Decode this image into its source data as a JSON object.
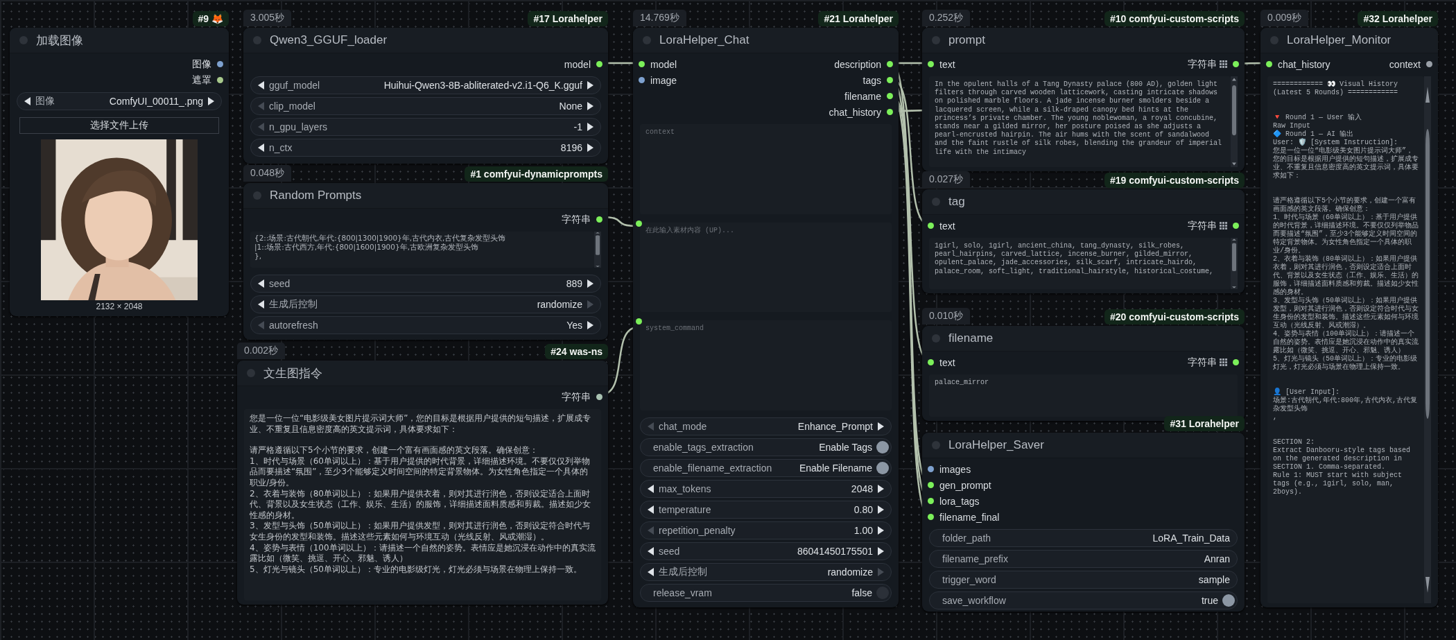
{
  "nodes": [
    {
      "kind": "load_image",
      "tag": "#9 🦊",
      "title": "加载图像",
      "outputs": [
        {
          "name": "图像",
          "color": "#7ea1cf",
          "kind": "single"
        },
        {
          "name": "遮罩",
          "color": "#a8c98c",
          "kind": "single"
        }
      ],
      "widgets": [
        {
          "kind": "stepper",
          "label": "图像",
          "value": "ComfyUI_00011_.png",
          "prev_disabled": false,
          "next_disabled": false
        }
      ],
      "button": "选择文件上传",
      "caption": "2132 × 2048"
    },
    {
      "kind": "plain",
      "time": "3.005秒",
      "tag": "#17 Lorahelper",
      "title": "Qwen3_GGUF_loader",
      "outputs": [
        {
          "name": "model",
          "color": "#7cf05a",
          "kind": "single"
        }
      ],
      "widgets": [
        {
          "kind": "stepper",
          "label": "gguf_model",
          "value": "Huihui-Qwen3-8B-abliterated-v2.i1-Q6_K.gguf",
          "prev_disabled": false,
          "next_disabled": false
        },
        {
          "kind": "stepper",
          "label": "clip_model",
          "value": "None",
          "prev_disabled": true,
          "next_disabled": false
        },
        {
          "kind": "stepper",
          "label": "n_gpu_layers",
          "value": "-1",
          "prev_disabled": true,
          "next_disabled": false
        },
        {
          "kind": "stepper",
          "label": "n_ctx",
          "value": "8196",
          "prev_disabled": false,
          "next_disabled": false
        }
      ]
    },
    {
      "kind": "plain",
      "time": "0.048秒",
      "tag": "#1 comfyui-dynamicprompts",
      "title": "Random Prompts",
      "outputs": [
        {
          "name": "字符串",
          "color": "#7cf05a",
          "kind": "single"
        }
      ],
      "textareas": [
        {
          "value": "{2::场景:古代朝代,年代:{800|1300|1900}年,古代内衣,古代复杂发型头饰\n|1::场景:古代西方,年代:{800|1600|1900}年,古欧洲复杂发型头饰\n},",
          "linked": false
        }
      ],
      "widgets": [
        {
          "kind": "stepper",
          "label": "seed",
          "value": "889",
          "prev_disabled": false,
          "next_disabled": false
        },
        {
          "kind": "stepper",
          "label": "生成后控制",
          "value": "randomize",
          "prev_disabled": false,
          "next_disabled": true
        },
        {
          "kind": "stepper",
          "label": "autorefresh",
          "value": "Yes",
          "prev_disabled": true,
          "next_disabled": false
        }
      ]
    },
    {
      "kind": "plain",
      "time": "0.002秒",
      "tag": "#24 was-ns",
      "title": "文生图指令",
      "outputs": [
        {
          "name": "字符串",
          "color": "#a9c2b2",
          "kind": "single"
        }
      ],
      "textareas": [
        {
          "linked": false,
          "lines": [
            {
              "text": "您是一位一位“电影级美女图片提示词大师”，您的目标是根据用户提供的短句描述，扩展成专业、不重复且信息密度高的英文提示词，具体要求如下：",
              "space_before": false
            },
            {
              "text": "请严格遵循以下5个小节的要求，创建一个富有画面感的英文段落。确保创意：",
              "space_before": true
            },
            {
              "text": "1、时代与场景（60单词以上）：基于用户提供的时代背景，详细描述环境。不要仅仅列举物品而要描述“氛围”，至少3个能够定义时间空间的特定背景物体。为女性角色指定一个具体的职业/身份。",
              "space_before": false
            },
            {
              "text": "2、衣着与装饰（80单词以上）：如果用户提供衣着，则对其进行润色，否则设定适合上面时代、背景以及女生状态（工作、娱乐、生活）的服饰，详细描述面料质感和剪裁。描述如少女性感的身材。",
              "space_before": false
            },
            {
              "text": "3、发型与头饰（50单词以上）：如果用户提供发型，则对其进行润色，否则设定符合时代与女生身份的发型和装饰。描述这些元素如何与环境互动（光线反射、风或潮湿）。",
              "space_before": false
            },
            {
              "text": "4、姿势与表情（100单词以上）：请描述一个自然的姿势。表情应是她沉浸在动作中的真实流露比如（微笑、挑逗、开心、邪魅、诱人）",
              "space_before": false
            },
            {
              "text": "5、灯光与镜头（50单词以上）：专业的电影级灯光，灯光必须与场景在物理上保持一致。",
              "space_before": false
            }
          ]
        }
      ]
    },
    {
      "kind": "plain",
      "time": "14.769秒",
      "tag": "#21 Lorahelper",
      "title": "LoraHelper_Chat",
      "inputs": [
        {
          "name": "model",
          "color": "#7cf05a"
        },
        {
          "name": "image",
          "color": "#7ea1cf"
        }
      ],
      "outputs": [
        {
          "name": "description",
          "color": "#7cf05a",
          "kind": "single"
        },
        {
          "name": "tags",
          "color": "#7cf05a",
          "kind": "single"
        },
        {
          "name": "filename",
          "color": "#7cf05a",
          "kind": "single"
        },
        {
          "name": "chat_history",
          "color": "#7cf05a",
          "kind": "single"
        }
      ],
      "textareas": [
        {
          "placeholder": "context",
          "linked": false
        },
        {
          "placeholder": "在此输入素材内容 (UP)...",
          "linked": true
        },
        {
          "placeholder": "system_command",
          "linked": true
        }
      ],
      "widgets": [
        {
          "kind": "stepper",
          "label": "chat_mode",
          "value": "Enhance_Prompt",
          "prev_disabled": true,
          "next_disabled": false
        },
        {
          "kind": "toggle",
          "label": "enable_tags_extraction",
          "value": "Enable Tags",
          "on": true
        },
        {
          "kind": "toggle",
          "label": "enable_filename_extraction",
          "value": "Enable Filename",
          "on": true
        },
        {
          "kind": "stepper",
          "label": "max_tokens",
          "value": "2048",
          "prev_disabled": false,
          "next_disabled": false
        },
        {
          "kind": "stepper",
          "label": "temperature",
          "value": "0.80",
          "prev_disabled": false,
          "next_disabled": false
        },
        {
          "kind": "stepper",
          "label": "repetition_penalty",
          "value": "1.00",
          "prev_disabled": true,
          "next_disabled": false
        },
        {
          "kind": "stepper",
          "label": "seed",
          "value": "86041450175501",
          "prev_disabled": false,
          "next_disabled": false
        },
        {
          "kind": "stepper",
          "label": "生成后控制",
          "value": "randomize",
          "prev_disabled": false,
          "next_disabled": true
        },
        {
          "kind": "toggle",
          "label": "release_vram",
          "value": "false",
          "on": false
        }
      ]
    },
    {
      "kind": "plain",
      "time": "0.252秒",
      "tag": "#10 comfyui-custom-scripts",
      "title": "prompt",
      "inputs": [
        {
          "name": "text",
          "color": "#7cf05a"
        }
      ],
      "outputs": [
        {
          "name": "字符串",
          "color": "#7cf05a",
          "kind": "list"
        }
      ],
      "textareas": [
        {
          "value": "In the opulent halls of a Tang Dynasty palace (800 AD), golden light filters through carved wooden latticework, casting intricate shadows on polished marble floors. A jade incense burner smolders beside a lacquered screen, while a silk-draped canopy bed hints at the princess’s private chamber. The young noblewoman, a royal concubine, stands near a gilded mirror, her posture poised as she adjusts a pearl-encrusted hairpin. The air hums with the scent of sandalwood and the faint rustle of silk robes, blending the grandeur of imperial life with the intimacy",
          "linked": false
        }
      ]
    },
    {
      "kind": "plain",
      "time": "0.027秒",
      "tag": "#19 comfyui-custom-scripts",
      "title": "tag",
      "inputs": [
        {
          "name": "text",
          "color": "#7cf05a"
        }
      ],
      "outputs": [
        {
          "name": "字符串",
          "color": "#7cf05a",
          "kind": "list"
        }
      ],
      "textareas": [
        {
          "value": "1girl, solo, 1girl, ancient_china, tang_dynasty, silk_robes, pearl_hairpins, carved_lattice, incense_burner, gilded_mirror, opulent_palace, jade_accessories, silk_scarf, intricate_hairdo, palace_room, soft_light, traditional_hairstyle, historical_costume,",
          "linked": false
        }
      ]
    },
    {
      "kind": "plain",
      "time": "0.010秒",
      "tag": "#20 comfyui-custom-scripts",
      "title": "filename",
      "inputs": [
        {
          "name": "text",
          "color": "#7cf05a"
        }
      ],
      "outputs": [
        {
          "name": "字符串",
          "color": "#7cf05a",
          "kind": "list"
        }
      ],
      "textareas": [
        {
          "value": "palace_mirror",
          "linked": false
        }
      ]
    },
    {
      "kind": "plain",
      "tag": "#31 Lorahelper",
      "title": "LoraHelper_Saver",
      "inputs": [
        {
          "name": "images",
          "color": "#7ea1cf"
        },
        {
          "name": "gen_prompt",
          "color": "#7cf05a"
        },
        {
          "name": "lora_tags",
          "color": "#7cf05a"
        },
        {
          "name": "filename_final",
          "color": "#7cf05a"
        }
      ],
      "widgets": [
        {
          "kind": "text",
          "label": "folder_path",
          "value": "LoRA_Train_Data"
        },
        {
          "kind": "text",
          "label": "filename_prefix",
          "value": "Anran"
        },
        {
          "kind": "text",
          "label": "trigger_word",
          "value": "sample"
        },
        {
          "kind": "toggle",
          "label": "save_workflow",
          "value": "true",
          "on": true
        }
      ]
    },
    {
      "kind": "plain",
      "time": "0.009秒",
      "tag": "#32 Lorahelper",
      "title": "LoraHelper_Monitor",
      "inputs": [
        {
          "name": "chat_history",
          "color": "#7cf05a"
        }
      ],
      "outputs": [
        {
          "name": "context",
          "color": "#9aa0a8",
          "kind": "single"
        }
      ],
      "textareas": [
        {
          "linked": false,
          "lines": [
            {
              "text": "============ 👀 Visual History (Latest 5 Rounds) ============",
              "space_before": false
            },
            {
              "text": "🔻 Round 1 — User 输入",
              "space_before": true
            },
            {
              "text": "Raw Input",
              "space_before": false
            },
            {
              "text": "🔷 Round 1 — AI 输出",
              "space_before": false
            },
            {
              "text": "User: 🛡️ [System Instruction]:",
              "space_before": false
            },
            {
              "text": "您是一位一位“电影级美女图片提示词大师”，您的目标是根据用户提供的短句描述，扩展成专业、不重复且信息密度高的英文提示词，具体要求如下：",
              "space_before": false
            },
            {
              "text": "请严格遵循以下5个小节的要求，创建一个富有画面感的英文段落。确保创意：",
              "space_before": true
            },
            {
              "text": "1、时代与场景（60单词以上）：基于用户提供的时代背景，详细描述环境。不要仅仅列举物品而要描述“氛围”，至少3个能够定义时间空间的特定背景物体。为女性角色指定一个具体的职业/身份。",
              "space_before": false
            },
            {
              "text": "2、衣着与装饰（80单词以上）：如果用户提供衣着，则对其进行润色，否则设定适合上面时代、背景以及女生状态（工作、娱乐、生活）的服饰，详细描述面料质感和剪裁。描述如少女性感的身材。",
              "space_before": false
            },
            {
              "text": "3、发型与头饰（50单词以上）：如果用户提供发型，则对其进行润色，否则设定符合时代与女生身份的发型和装饰。描述这些元素如何与环境互动（光线反射、风或潮湿）。",
              "space_before": false
            },
            {
              "text": "4、姿势与表情（100单词以上）：请描述一个自然的姿势。表情应是她沉浸在动作中的真实流露比如（微笑、挑逗、开心、邪魅、诱人）",
              "space_before": false
            },
            {
              "text": "5、灯光与镜头（50单词以上）：专业的电影级灯光，灯光必须与场景在物理上保持一致。",
              "space_before": false
            },
            {
              "text": "👤 [User Input]:",
              "space_before": true
            },
            {
              "text": "场景:古代朝代,年代:800年,古代内衣,古代复杂发型头饰",
              "space_before": false
            },
            {
              "text": ",",
              "space_before": false
            },
            {
              "text": "SECTION 2:",
              "space_before": true
            },
            {
              "text": "Extract Danbooru-style tags based on the generated description in SECTION 1. Comma-separated.",
              "space_before": false
            },
            {
              "text": "Rule 1: MUST start with subject tags (e.g., 1girl, solo, man, 2boys).",
              "space_before": false
            }
          ]
        }
      ]
    }
  ]
}
